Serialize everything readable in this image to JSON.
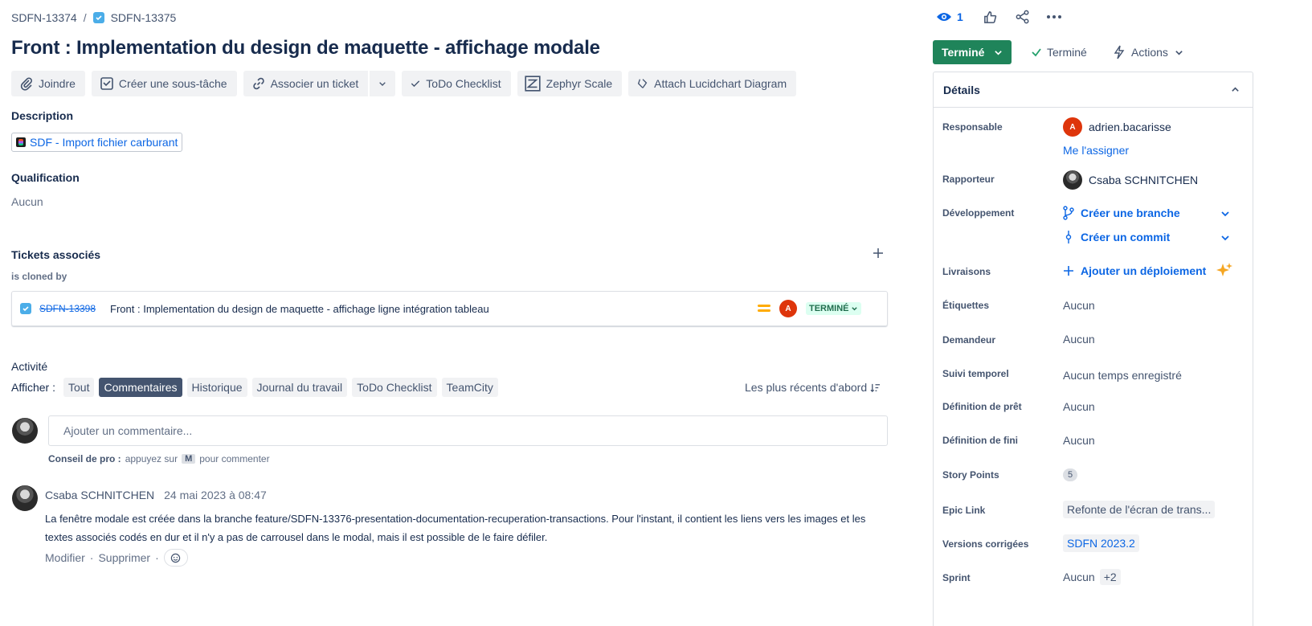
{
  "breadcrumb": {
    "parent": "SDFN-13374",
    "separator": "/",
    "current": "SDFN-13375"
  },
  "title": "Front : Implementation du design de maquette - affichage modale",
  "toolbar": {
    "attach": "Joindre",
    "subtask": "Créer une sous-tâche",
    "link_issue": "Associer un ticket",
    "todo": "ToDo Checklist",
    "zephyr": "Zephyr Scale",
    "lucid": "Attach Lucidchart Diagram"
  },
  "description": {
    "heading": "Description",
    "attachment": "SDF - Import fichier carburant"
  },
  "qualification": {
    "heading": "Qualification",
    "value": "Aucun"
  },
  "linked": {
    "heading": "Tickets associés",
    "relation": "is cloned by",
    "item": {
      "key": "SDFN-13398",
      "summary": "Front : Implementation du design de maquette - affichage ligne intégration tableau",
      "avatar": "A",
      "status": "TERMINÉ"
    }
  },
  "activity": {
    "heading": "Activité",
    "show_label": "Afficher :",
    "filters": [
      "Tout",
      "Commentaires",
      "Historique",
      "Journal du travail",
      "ToDo Checklist",
      "TeamCity"
    ],
    "active_filter": "Commentaires",
    "sort": "Les plus récents d'abord",
    "comment_placeholder": "Ajouter un commentaire...",
    "tip_bold": "Conseil de pro :",
    "tip_pre": "appuyez sur",
    "tip_key": "M",
    "tip_post": "pour commenter"
  },
  "comment": {
    "author": "Csaba SCHNITCHEN",
    "date": "24 mai 2023 à 08:47",
    "line1": "La fenêtre modale est créée dans la branche feature/SDFN-13376-presentation-documentation-recuperation-transactions. Pour l'instant, il contient les liens vers les images et les",
    "line2": "textes associés codés en dur et il n'y a pas de carrousel dans le modal, mais il est possible de le faire défiler.",
    "edit": "Modifier",
    "delete": "Supprimer",
    "dot": "·"
  },
  "top_actions": {
    "watchers": "1"
  },
  "status_button": "Terminé",
  "resolution": "Terminé",
  "actions_label": "Actions",
  "details": {
    "heading": "Détails",
    "assignee_label": "Responsable",
    "assignee_avatar": "A",
    "assignee": "adrien.bacarisse",
    "assign_me": "Me l'assigner",
    "reporter_label": "Rapporteur",
    "reporter": "Csaba SCHNITCHEN",
    "dev_label": "Développement",
    "create_branch": "Créer une branche",
    "create_commit": "Créer un commit",
    "releases_label": "Livraisons",
    "add_deployment": "Ajouter un déploiement",
    "labels_label": "Étiquettes",
    "labels": "Aucun",
    "requester_label": "Demandeur",
    "requester": "Aucun",
    "time_label": "Suivi temporel",
    "time": "Aucun temps enregistré",
    "dor_label": "Définition de prêt",
    "dor": "Aucun",
    "dod_label": "Définition de fini",
    "dod": "Aucun",
    "sp_label": "Story Points",
    "sp": "5",
    "epic_label": "Epic Link",
    "epic": "Refonte de l'écran de trans...",
    "fix_label": "Versions corrigées",
    "fix": "SDFN 2023.2",
    "sprint_label": "Sprint",
    "sprint": "Aucun",
    "sprint_more": "+2"
  },
  "colors": {
    "primary": "#0c66e4",
    "success": "#1f845a",
    "text": "#172b4d",
    "subtle": "#44546f",
    "priority": "#ffab00"
  }
}
